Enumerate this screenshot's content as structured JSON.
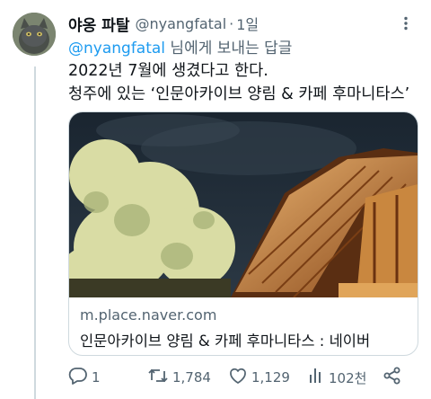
{
  "tweet": {
    "display_name": "야옹 파탈",
    "handle": "@nyangfatal",
    "separator": "·",
    "time": "1일",
    "reply_mention": "@nyangfatal",
    "reply_suffix": " 님에게 보내는 답글",
    "text_lines": [
      "2022년 7월에 생겼다고 한다.",
      "청주에 있는 ‘인문아카이브 양림 & 카페 후마니타스’"
    ]
  },
  "card": {
    "domain": "m.place.naver.com",
    "title": "인문아카이브 양림 & 카페 후마니타스 : 네이버"
  },
  "actions": {
    "replies": "1",
    "retweets": "1,784",
    "likes": "1,129",
    "views": "102천"
  },
  "colors": {
    "link": "#1d9bf0",
    "secondary_text": "#536471",
    "border": "#cfd9de"
  },
  "icons": [
    "more-icon",
    "reply-icon",
    "retweet-icon",
    "like-icon",
    "views-icon",
    "share-icon"
  ]
}
